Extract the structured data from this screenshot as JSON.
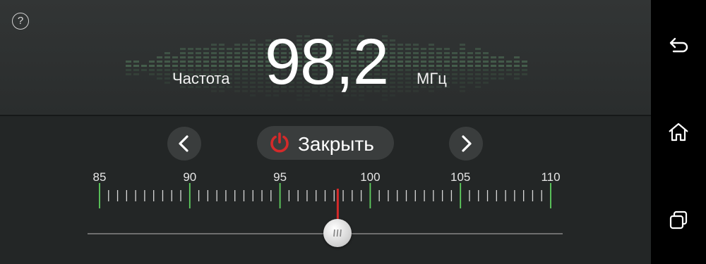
{
  "header": {
    "help_icon": "question-icon",
    "help_label": "?",
    "frequency_label": "Частота",
    "frequency_value": "98,2",
    "frequency_unit": "МГц"
  },
  "controls": {
    "prev_icon": "chevron-left-icon",
    "close_icon": "power-icon",
    "close_label": "Закрыть",
    "next_icon": "chevron-right-icon"
  },
  "scale": {
    "min": 85,
    "max": 110,
    "minor_step": 0.5,
    "major_labels": [
      "85",
      "90",
      "95",
      "100",
      "105",
      "110"
    ],
    "current": 98.2,
    "colors": {
      "major_tick": "#5fcf5f",
      "minor_tick": "#d8d8d8",
      "indicator": "#d42a2a"
    }
  },
  "nav": {
    "back_icon": "back-arrow-icon",
    "home_icon": "home-icon",
    "recent_icon": "recent-apps-icon"
  }
}
